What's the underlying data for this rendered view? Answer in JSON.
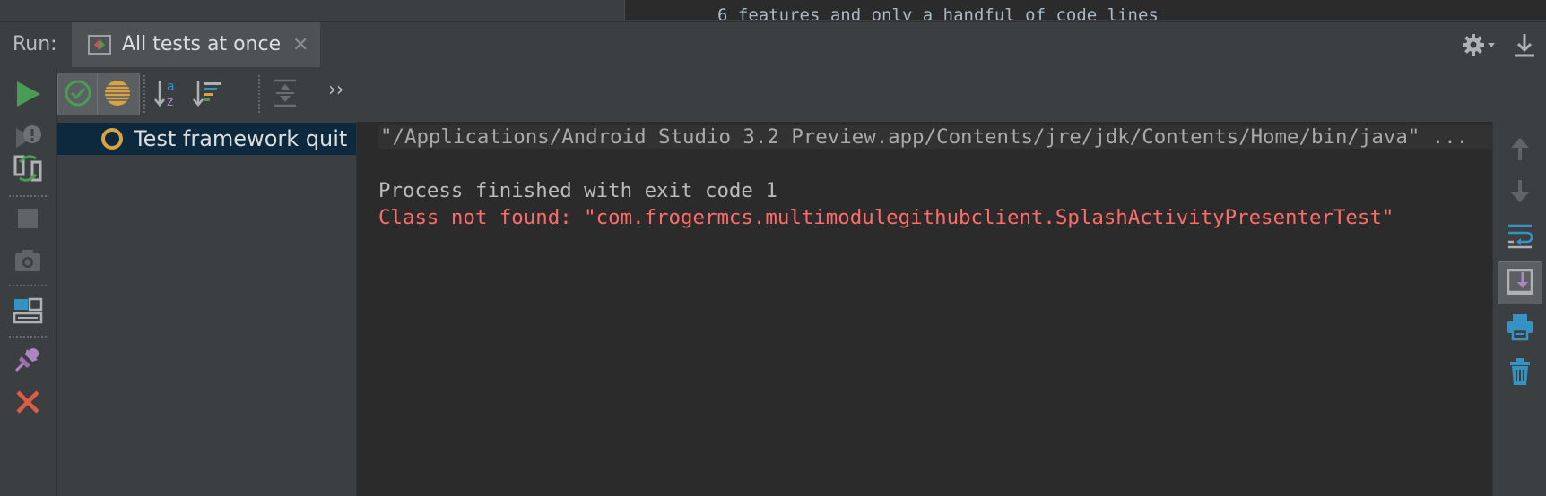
{
  "top_strip": {
    "text": "6 features and only a handful of code lines"
  },
  "header": {
    "run_label": "Run:",
    "tab": {
      "label": "All tests at once",
      "close": "✕"
    }
  },
  "left_toolbar": [
    "rerun-icon",
    "stop-exclamation-icon",
    "toggle-auto-test-icon",
    "stop-icon",
    "camera-icon",
    "layout-icon",
    "pin-icon",
    "close-icon"
  ],
  "test_toolbar": [
    "show-passed-icon",
    "show-ignored-icon",
    "sort-alphabetically-icon",
    "sort-by-duration-icon",
    "expand-all-icon",
    "more-chevron"
  ],
  "more_label": "››",
  "tree": {
    "items": [
      {
        "label": "Test framework quit",
        "status": "ignored"
      }
    ]
  },
  "console": {
    "lines": [
      {
        "text": "\"/Applications/Android Studio 3.2 Preview.app/Contents/jre/jdk/Contents/Home/bin/java\" ...",
        "kind": "command"
      },
      {
        "text": "Process finished with exit code 1",
        "kind": "normal"
      },
      {
        "text": "Class not found: \"com.frogermcs.multimodulegithubclient.SplashActivityPresenterTest\"",
        "kind": "error"
      }
    ]
  },
  "right_toolbar": [
    "up-arrow-icon",
    "down-arrow-icon",
    "soft-wrap-icon",
    "scroll-to-end-icon",
    "print-icon",
    "trash-icon"
  ],
  "colors": {
    "accent_green": "#499c54",
    "error_red": "#ff6b68",
    "selection": "#0d293e",
    "info_blue": "#3592c4",
    "warning_orange": "#d9a343"
  }
}
